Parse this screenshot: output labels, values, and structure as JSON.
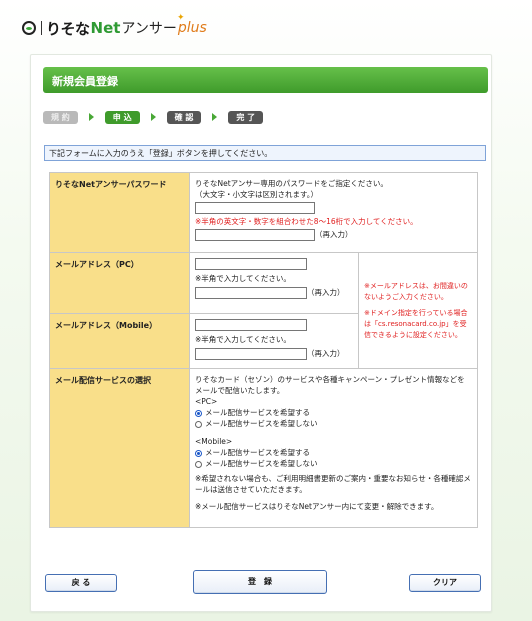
{
  "header": {
    "brand_name": "りそな",
    "brand_net": "Net",
    "brand_answer": "アンサー",
    "brand_plus": "plus"
  },
  "page": {
    "title": "新規会員登録",
    "instruction": "下記フォームに入力のうえ「登録」ボタンを押してください。"
  },
  "steps": [
    {
      "label": "規 約",
      "state": "done"
    },
    {
      "label": "申 込",
      "state": "current"
    },
    {
      "label": "確 認",
      "state": "todo"
    },
    {
      "label": "完 了",
      "state": "todo"
    }
  ],
  "form": {
    "password": {
      "label": "りそなNetアンサーパスワード",
      "desc1": "りそなNetアンサー専用のパスワードをご指定ください。",
      "desc2": "（大文字・小文字は区別されます。）",
      "note_pre": "※",
      "note_red": "半角の英文字・数字",
      "note_post": "を組合わせた8～16桁で入力してください。",
      "value": "",
      "confirm_value": "",
      "confirm_suffix": "（再入力）"
    },
    "email_pc": {
      "label": "メールアドレス（PC）",
      "note": "※半角で入力してください。",
      "value": "",
      "confirm_value": "",
      "confirm_suffix": "（再入力）"
    },
    "email_mobile": {
      "label": "メールアドレス（Mobile）",
      "note": "※半角で入力してください。",
      "value": "",
      "confirm_value": "",
      "confirm_suffix": "（再入力）"
    },
    "email_notes": {
      "note1": "※メールアドレスは、お間違いのないようご入力ください。",
      "note2": "※ドメイン指定を行っている場合は「cs.resonacard.co.jp」を受信できるように設定ください。"
    },
    "mail_service": {
      "label": "メール配信サービスの選択",
      "desc": "りそなカード（セゾン）のサービスや各種キャンペーン・プレゼント情報などをメールで配信いたします。",
      "pc_heading": "<PC>",
      "mobile_heading": "<Mobile>",
      "opt_yes": "メール配信サービスを希望する",
      "opt_no": "メール配信サービスを希望しない",
      "pc_selected": "yes",
      "mobile_selected": "yes",
      "note1": "※希望されない場合も、ご利用明細書更新のご案内・重要なお知らせ・各種確認メールは送信させていただきます。",
      "note2": "※メール配信サービスはりそなNetアンサー内にて変更・解除できます。"
    }
  },
  "buttons": {
    "back": "戻 る",
    "register": "登　録",
    "clear": "クリア"
  },
  "colors": {
    "title_bar": "#4aa836",
    "label_bg": "#f9df8a",
    "note_red": "#e02020",
    "button_border": "#456fb3"
  }
}
